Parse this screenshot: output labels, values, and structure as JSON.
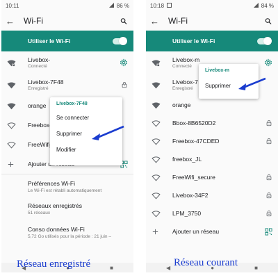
{
  "left": {
    "status": {
      "time": "10:11",
      "battery": "86 %"
    },
    "title": "Wi-Fi",
    "toggle_label": "Utiliser le Wi-Fi",
    "networks": [
      {
        "name": "Livebox-",
        "sub": "Connecté",
        "icon": "wifi-locked-icon",
        "end": "gear-icon"
      },
      {
        "name": "Livebox-7F48",
        "sub": "Enregistré",
        "icon": "wifi-icon",
        "end": "lock-icon"
      },
      {
        "name": "orange",
        "sub": "",
        "icon": "wifi-icon",
        "end": ""
      },
      {
        "name": "Freebox-",
        "sub": "",
        "icon": "wifi-outline-icon",
        "end": ""
      },
      {
        "name": "FreeWifi_",
        "sub": "",
        "icon": "wifi-outline-icon",
        "end": ""
      }
    ],
    "add_network": "Ajouter un réseau",
    "settings": [
      {
        "name": "Préférences Wi-Fi",
        "sub": "Le Wi-Fi est rétabli automatiquement"
      },
      {
        "name": "Réseaux enregistrés",
        "sub": "51 réseaux"
      },
      {
        "name": "Conso données Wi-Fi",
        "sub": "5,72 Go utilisés pour la période : 21 juin –"
      }
    ],
    "popup": {
      "header": "Livebox-7F48",
      "items": [
        "Se connecter",
        "Supprimer",
        "Modifier"
      ]
    },
    "caption": "Réseau enregistré"
  },
  "right": {
    "status": {
      "time": "10:18",
      "battery": "84 %"
    },
    "title": "Wi-Fi",
    "toggle_label": "Utiliser le Wi-Fi",
    "networks": [
      {
        "name": "Livebox-m",
        "sub": "Connecté",
        "icon": "wifi-locked-icon",
        "end": "gear-icon"
      },
      {
        "name": "Livebox-7",
        "sub": "Enregistré",
        "icon": "wifi-icon",
        "end": ""
      },
      {
        "name": "orange",
        "sub": "",
        "icon": "wifi-icon",
        "end": ""
      },
      {
        "name": "Bbox-8B6520D2",
        "sub": "",
        "icon": "wifi-outline-icon",
        "end": "lock-icon"
      },
      {
        "name": "Freebox-47CDED",
        "sub": "",
        "icon": "wifi-outline-icon",
        "end": "lock-icon"
      },
      {
        "name": "freebox_JL",
        "sub": "",
        "icon": "wifi-outline-icon",
        "end": ""
      },
      {
        "name": "FreeWifi_secure",
        "sub": "",
        "icon": "wifi-outline-icon",
        "end": "lock-icon"
      },
      {
        "name": "Livebox-34F2",
        "sub": "",
        "icon": "wifi-outline-icon",
        "end": "lock-icon"
      },
      {
        "name": "LPM_3750",
        "sub": "",
        "icon": "wifi-outline-icon",
        "end": "lock-icon"
      }
    ],
    "add_network": "Ajouter un réseau",
    "popup": {
      "header": "Livebox-m",
      "items": [
        "Supprimer"
      ]
    },
    "caption": "Réseau courant"
  },
  "colors": {
    "accent": "#16897a",
    "annotation": "#1a3ccf"
  }
}
